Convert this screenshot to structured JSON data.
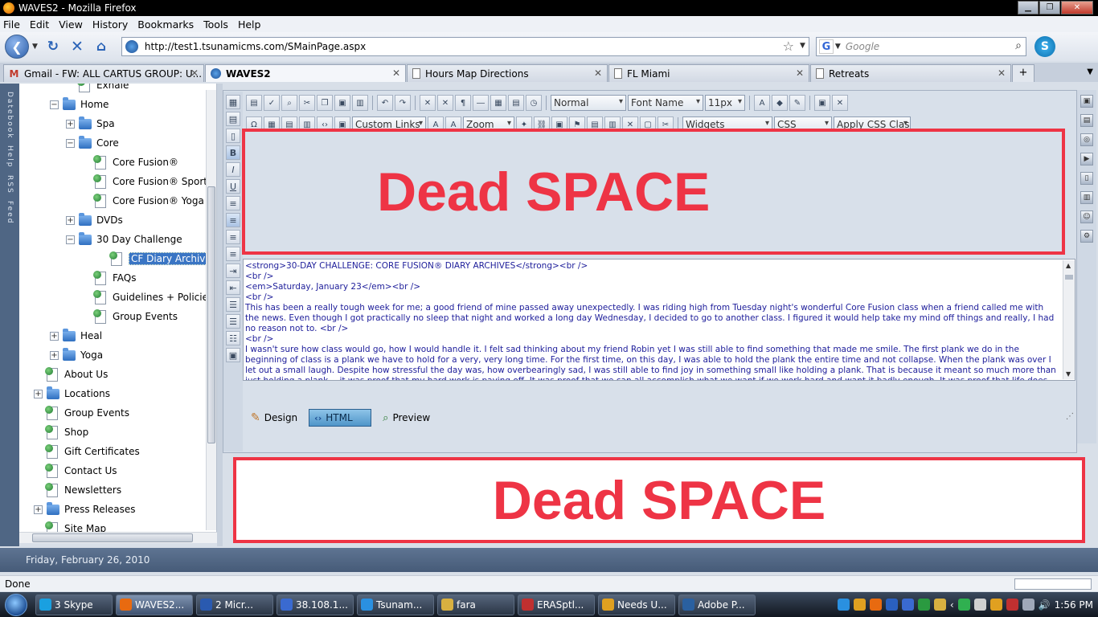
{
  "window": {
    "title": "WAVES2 - Mozilla Firefox"
  },
  "menu": [
    "File",
    "Edit",
    "View",
    "History",
    "Bookmarks",
    "Tools",
    "Help"
  ],
  "nav": {
    "url": "http://test1.tsunamicms.com/SMainPage.aspx",
    "search_placeholder": "Google"
  },
  "tabs": [
    {
      "label": "Gmail - FW: ALL CARTUS GROUP: U...",
      "icon": "gmail-icon"
    },
    {
      "label": "WAVES2",
      "icon": "globe-icon",
      "active": true
    },
    {
      "label": "Hours Map Directions",
      "icon": "page-icon"
    },
    {
      "label": "FL Miami",
      "icon": "page-icon"
    },
    {
      "label": "Retreats",
      "icon": "page-icon"
    }
  ],
  "left_strip": [
    "Datebook",
    "Help",
    "RSS",
    "Feed"
  ],
  "tree": {
    "items": [
      {
        "label": "Exhale",
        "type": "page"
      },
      {
        "label": "Home",
        "type": "folder",
        "exp": "−"
      },
      {
        "label": "Spa",
        "type": "folder",
        "exp": "+"
      },
      {
        "label": "Core",
        "type": "folder",
        "exp": "−"
      },
      {
        "label": "Core Fusion®",
        "type": "page"
      },
      {
        "label": "Core Fusion® Sport",
        "type": "page"
      },
      {
        "label": "Core Fusion® Yoga",
        "type": "page"
      },
      {
        "label": "DVDs",
        "type": "folder",
        "exp": "+"
      },
      {
        "label": "30 Day Challenge",
        "type": "folder",
        "exp": "−"
      },
      {
        "label": "CF Diary Archives",
        "type": "page",
        "selected": true
      },
      {
        "label": "FAQs",
        "type": "page"
      },
      {
        "label": "Guidelines + Policies",
        "type": "page"
      },
      {
        "label": "Group Events",
        "type": "page"
      },
      {
        "label": "Heal",
        "type": "folder",
        "exp": "+"
      },
      {
        "label": "Yoga",
        "type": "folder",
        "exp": "+"
      },
      {
        "label": "About Us",
        "type": "page"
      },
      {
        "label": "Locations",
        "type": "folder",
        "exp": "+"
      },
      {
        "label": "Group Events",
        "type": "page"
      },
      {
        "label": "Shop",
        "type": "page"
      },
      {
        "label": "Gift Certificates",
        "type": "page"
      },
      {
        "label": "Contact Us",
        "type": "page"
      },
      {
        "label": "Newsletters",
        "type": "page"
      },
      {
        "label": "Press Releases",
        "type": "folder",
        "exp": "+"
      },
      {
        "label": "Site Map",
        "type": "page"
      }
    ]
  },
  "toolbar": {
    "format": "Normal",
    "font_name": "Font Name",
    "font_size": "11px",
    "custom_links": "Custom Links",
    "zoom": "Zoom",
    "widgets": "Widgets",
    "css": "CSS",
    "apply_css": "Apply CSS Clas"
  },
  "annotations": {
    "dead_top": "Dead SPACE",
    "dead_bottom": "Dead SPACE"
  },
  "source_lines": [
    "<strong>30-DAY CHALLENGE: CORE FUSION® DIARY ARCHIVES</strong><br />",
    "<br />",
    "<em>Saturday, January 23</em><br />",
    "<br />",
    "This has been a really tough week for me; a good friend of mine passed away unexpectedly. I was riding high from Tuesday night's wonderful Core Fusion class when a friend called me with the news. Even though I got practically no sleep that night and worked a long day Wednesday, I decided to go to another class. I figured it would help take my mind off things and really, I had no reason not to. <br />",
    "<br />",
    "I wasn't sure how class would go, how I would handle it. I felt sad thinking about my friend Robin yet I was still able to find something that made me smile. The first plank we do in the beginning of class is a plank we have to hold for a very, very long time. For the first time, on this day, I was able to hold the plank the entire time and not collapse. When the plank was over I let out a small laugh. Despite how stressful the day was, how overbearingly sad, I was still able to find joy in something small like holding a plank. That is because it meant so much more than just holding a plank -- it was proof that my hard work is paying off. It was proof that we can all accomplish what we want if we work hard and want it badly enough. It was proof that life does go on and we should live it as our best possible selves -- as healthy, as strong, as accomplished as we can be. Yes, part of it was physical -- I am physically stronger now than I was before this challenge. But it was also mental -- I wanted to hold this plank more on Wednesday than I ever have"
  ],
  "modes": {
    "design": "Design",
    "html": "HTML",
    "preview": "Preview"
  },
  "datebar": "Friday, February 26, 2010",
  "status": "Done",
  "taskbar": {
    "items": [
      {
        "label": "3 Skype",
        "color": "#1aa0e0"
      },
      {
        "label": "WAVES2...",
        "color": "#e86a10",
        "active": true
      },
      {
        "label": "2 Micr...",
        "color": "#2a5ab0"
      },
      {
        "label": "38.108.1...",
        "color": "#3a6ad0"
      },
      {
        "label": "Tsunam...",
        "color": "#2a90e0"
      },
      {
        "label": "fara",
        "color": "#d8b040"
      },
      {
        "label": "ERASptl...",
        "color": "#c03030"
      },
      {
        "label": "Needs U...",
        "color": "#e0a020"
      },
      {
        "label": "Adobe P...",
        "color": "#2a60a0"
      }
    ],
    "clock": "1:56 PM"
  }
}
